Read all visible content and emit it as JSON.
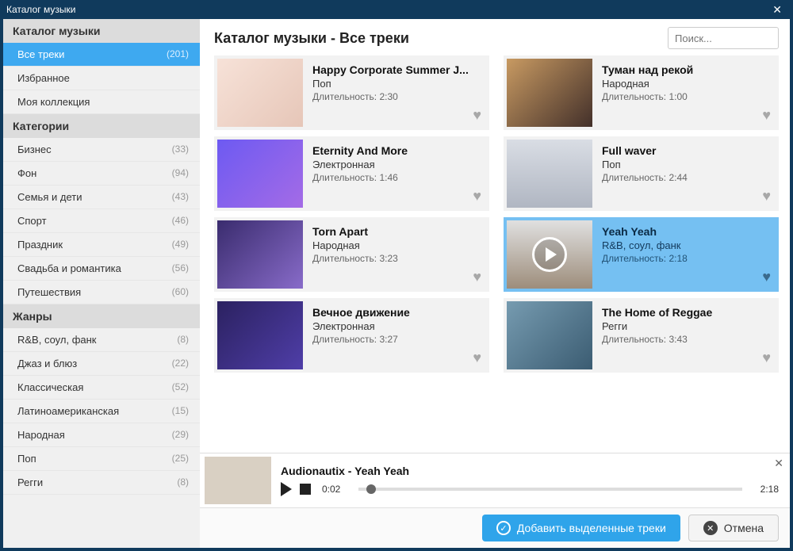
{
  "window": {
    "title": "Каталог музыки"
  },
  "sidebar": {
    "sections": [
      {
        "header": "Каталог музыки",
        "items": [
          {
            "label": "Все треки",
            "count": "(201)",
            "selected": true
          },
          {
            "label": "Избранное",
            "count": ""
          },
          {
            "label": "Моя коллекция",
            "count": ""
          }
        ]
      },
      {
        "header": "Категории",
        "items": [
          {
            "label": "Бизнес",
            "count": "(33)"
          },
          {
            "label": "Фон",
            "count": "(94)"
          },
          {
            "label": "Семья и дети",
            "count": "(43)"
          },
          {
            "label": "Спорт",
            "count": "(46)"
          },
          {
            "label": "Праздник",
            "count": "(49)"
          },
          {
            "label": "Свадьба и романтика",
            "count": "(56)"
          },
          {
            "label": "Путешествия",
            "count": "(60)"
          }
        ]
      },
      {
        "header": "Жанры",
        "items": [
          {
            "label": "R&B, соул, фанк",
            "count": "(8)"
          },
          {
            "label": "Джаз и блюз",
            "count": "(22)"
          },
          {
            "label": "Классическая",
            "count": "(52)"
          },
          {
            "label": "Латиноамериканская",
            "count": "(15)"
          },
          {
            "label": "Народная",
            "count": "(29)"
          },
          {
            "label": "Поп",
            "count": "(25)"
          },
          {
            "label": "Регги",
            "count": "(8)"
          }
        ]
      }
    ]
  },
  "main": {
    "heading": "Каталог музыки - Все треки",
    "search_placeholder": "Поиск...",
    "duration_label": "Длительность:",
    "tracks": [
      {
        "title": "Happy Corporate Summer J...",
        "genre": "Поп",
        "duration": "2:30",
        "thumb": "th0"
      },
      {
        "title": "Туман над рекой",
        "genre": "Народная",
        "duration": "1:00",
        "thumb": "th1"
      },
      {
        "title": "Eternity And More",
        "genre": "Электронная",
        "duration": "1:46",
        "thumb": "th2"
      },
      {
        "title": "Full waver",
        "genre": "Поп",
        "duration": "2:44",
        "thumb": "th3"
      },
      {
        "title": "Torn Apart",
        "genre": "Народная",
        "duration": "3:23",
        "thumb": "th4"
      },
      {
        "title": "Yeah Yeah",
        "genre": "R&B, соул, фанк",
        "duration": "2:18",
        "thumb": "th5",
        "selected": true,
        "play_overlay": true
      },
      {
        "title": "Вечное движение",
        "genre": "Электронная",
        "duration": "3:27",
        "thumb": "th6"
      },
      {
        "title": "The Home of Reggae",
        "genre": "Регги",
        "duration": "3:43",
        "thumb": "th7"
      }
    ]
  },
  "player": {
    "now_playing": "Audionautix - Yeah Yeah",
    "elapsed": "0:02",
    "total": "2:18"
  },
  "footer": {
    "add_label": "Добавить выделенные треки",
    "cancel_label": "Отмена"
  }
}
